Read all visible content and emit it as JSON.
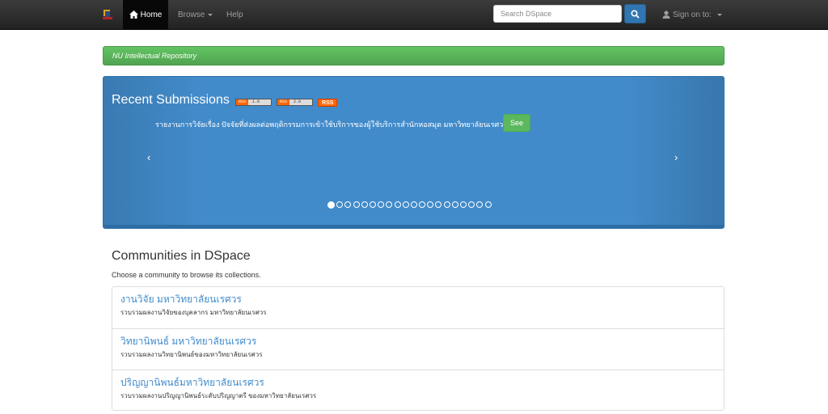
{
  "navbar": {
    "home_label": "Home",
    "browse_label": "Browse",
    "help_label": "Help",
    "search_placeholder": "Search DSpace",
    "signon_label": "Sign on to:"
  },
  "banner": {
    "text": "NU Intellectual Repository"
  },
  "carousel": {
    "title": "Recent Submissions",
    "feeds": [
      {
        "left": "RSS",
        "right": "1.0"
      },
      {
        "left": "RSS",
        "right": "2.0"
      }
    ],
    "rss_label": "RSS",
    "item_text": "รายงานการวิจัยเรื่อง ปัจจัยที่ส่งผลต่อพฤติกรรมการเข้าใช้บริการของผู้ใช้บริการสำนักหอสมุด มหาวิทยาลัยนเรศวร",
    "see_label": "See",
    "prev_glyph": "‹",
    "next_glyph": "›",
    "slide_count": 20,
    "active_slide": 0
  },
  "communities": {
    "title": "Communities in DSpace",
    "subtitle": "Choose a community to browse its collections.",
    "items": [
      {
        "name": "งานวิจัย มหาวิทยาลัยนเรศวร",
        "description": "รวบรวมผลงานวิจัยของบุคลากร มหาวิทยาลัยนเรศวร"
      },
      {
        "name": "วิทยานิพนธ์ มหาวิทยาลัยนเรศวร",
        "description": "รวบรวมผลงานวิทยานิพนธ์ของมหาวิทยาลัยนเรศวร"
      },
      {
        "name": "ปริญญานิพนธ์มหาวิทยาลัยนเรศวร",
        "description": "รวบรวมผลงานปริญญานิพนธ์ระดับปริญญาตรี ของมหาวิทยาลัยนเรศวร"
      }
    ]
  },
  "colors": {
    "navbar": "#222222",
    "accent_blue": "#428bca",
    "success_green": "#5cb85c"
  }
}
